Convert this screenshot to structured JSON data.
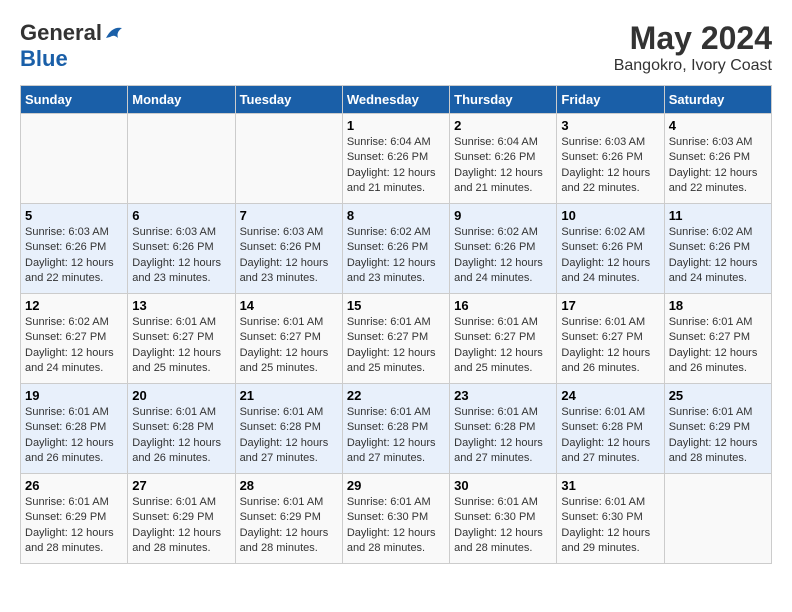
{
  "logo": {
    "general": "General",
    "blue": "Blue"
  },
  "title": "May 2024",
  "location": "Bangokro, Ivory Coast",
  "days_of_week": [
    "Sunday",
    "Monday",
    "Tuesday",
    "Wednesday",
    "Thursday",
    "Friday",
    "Saturday"
  ],
  "weeks": [
    [
      {
        "day": "",
        "content": ""
      },
      {
        "day": "",
        "content": ""
      },
      {
        "day": "",
        "content": ""
      },
      {
        "day": "1",
        "content": "Sunrise: 6:04 AM\nSunset: 6:26 PM\nDaylight: 12 hours\nand 21 minutes."
      },
      {
        "day": "2",
        "content": "Sunrise: 6:04 AM\nSunset: 6:26 PM\nDaylight: 12 hours\nand 21 minutes."
      },
      {
        "day": "3",
        "content": "Sunrise: 6:03 AM\nSunset: 6:26 PM\nDaylight: 12 hours\nand 22 minutes."
      },
      {
        "day": "4",
        "content": "Sunrise: 6:03 AM\nSunset: 6:26 PM\nDaylight: 12 hours\nand 22 minutes."
      }
    ],
    [
      {
        "day": "5",
        "content": "Sunrise: 6:03 AM\nSunset: 6:26 PM\nDaylight: 12 hours\nand 22 minutes."
      },
      {
        "day": "6",
        "content": "Sunrise: 6:03 AM\nSunset: 6:26 PM\nDaylight: 12 hours\nand 23 minutes."
      },
      {
        "day": "7",
        "content": "Sunrise: 6:03 AM\nSunset: 6:26 PM\nDaylight: 12 hours\nand 23 minutes."
      },
      {
        "day": "8",
        "content": "Sunrise: 6:02 AM\nSunset: 6:26 PM\nDaylight: 12 hours\nand 23 minutes."
      },
      {
        "day": "9",
        "content": "Sunrise: 6:02 AM\nSunset: 6:26 PM\nDaylight: 12 hours\nand 24 minutes."
      },
      {
        "day": "10",
        "content": "Sunrise: 6:02 AM\nSunset: 6:26 PM\nDaylight: 12 hours\nand 24 minutes."
      },
      {
        "day": "11",
        "content": "Sunrise: 6:02 AM\nSunset: 6:26 PM\nDaylight: 12 hours\nand 24 minutes."
      }
    ],
    [
      {
        "day": "12",
        "content": "Sunrise: 6:02 AM\nSunset: 6:27 PM\nDaylight: 12 hours\nand 24 minutes."
      },
      {
        "day": "13",
        "content": "Sunrise: 6:01 AM\nSunset: 6:27 PM\nDaylight: 12 hours\nand 25 minutes."
      },
      {
        "day": "14",
        "content": "Sunrise: 6:01 AM\nSunset: 6:27 PM\nDaylight: 12 hours\nand 25 minutes."
      },
      {
        "day": "15",
        "content": "Sunrise: 6:01 AM\nSunset: 6:27 PM\nDaylight: 12 hours\nand 25 minutes."
      },
      {
        "day": "16",
        "content": "Sunrise: 6:01 AM\nSunset: 6:27 PM\nDaylight: 12 hours\nand 25 minutes."
      },
      {
        "day": "17",
        "content": "Sunrise: 6:01 AM\nSunset: 6:27 PM\nDaylight: 12 hours\nand 26 minutes."
      },
      {
        "day": "18",
        "content": "Sunrise: 6:01 AM\nSunset: 6:27 PM\nDaylight: 12 hours\nand 26 minutes."
      }
    ],
    [
      {
        "day": "19",
        "content": "Sunrise: 6:01 AM\nSunset: 6:28 PM\nDaylight: 12 hours\nand 26 minutes."
      },
      {
        "day": "20",
        "content": "Sunrise: 6:01 AM\nSunset: 6:28 PM\nDaylight: 12 hours\nand 26 minutes."
      },
      {
        "day": "21",
        "content": "Sunrise: 6:01 AM\nSunset: 6:28 PM\nDaylight: 12 hours\nand 27 minutes."
      },
      {
        "day": "22",
        "content": "Sunrise: 6:01 AM\nSunset: 6:28 PM\nDaylight: 12 hours\nand 27 minutes."
      },
      {
        "day": "23",
        "content": "Sunrise: 6:01 AM\nSunset: 6:28 PM\nDaylight: 12 hours\nand 27 minutes."
      },
      {
        "day": "24",
        "content": "Sunrise: 6:01 AM\nSunset: 6:28 PM\nDaylight: 12 hours\nand 27 minutes."
      },
      {
        "day": "25",
        "content": "Sunrise: 6:01 AM\nSunset: 6:29 PM\nDaylight: 12 hours\nand 28 minutes."
      }
    ],
    [
      {
        "day": "26",
        "content": "Sunrise: 6:01 AM\nSunset: 6:29 PM\nDaylight: 12 hours\nand 28 minutes."
      },
      {
        "day": "27",
        "content": "Sunrise: 6:01 AM\nSunset: 6:29 PM\nDaylight: 12 hours\nand 28 minutes."
      },
      {
        "day": "28",
        "content": "Sunrise: 6:01 AM\nSunset: 6:29 PM\nDaylight: 12 hours\nand 28 minutes."
      },
      {
        "day": "29",
        "content": "Sunrise: 6:01 AM\nSunset: 6:30 PM\nDaylight: 12 hours\nand 28 minutes."
      },
      {
        "day": "30",
        "content": "Sunrise: 6:01 AM\nSunset: 6:30 PM\nDaylight: 12 hours\nand 28 minutes."
      },
      {
        "day": "31",
        "content": "Sunrise: 6:01 AM\nSunset: 6:30 PM\nDaylight: 12 hours\nand 29 minutes."
      },
      {
        "day": "",
        "content": ""
      }
    ]
  ]
}
